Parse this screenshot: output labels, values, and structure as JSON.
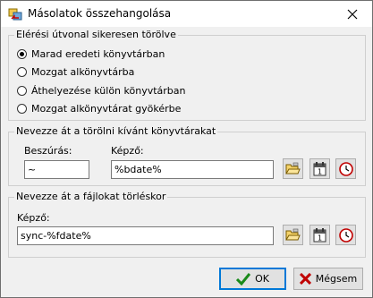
{
  "window": {
    "title": "Másolatok összehangolása"
  },
  "group1": {
    "title": "Elérési útvonal sikeresen törölve",
    "options": [
      {
        "label": "Marad eredeti könyvtárban",
        "checked": true
      },
      {
        "label": "Mozgat alkönyvtárba",
        "checked": false
      },
      {
        "label": "Áthelyezése külön könyvtárban",
        "checked": false
      },
      {
        "label": "Mozgat alkönyvtárat gyökérbe",
        "checked": false
      }
    ]
  },
  "group2": {
    "title": "Nevezze át a törölni kívánt könyvtárakat",
    "insert_label": "Beszúrás:",
    "insert_value": "~",
    "pattern_label": "Képző:",
    "pattern_value": "%bdate%"
  },
  "group3": {
    "title": "Nevezze át a fájlokat törléskor",
    "pattern_label": "Képző:",
    "pattern_value": "sync-%fdate%"
  },
  "buttons": {
    "ok": "OK",
    "cancel": "Mégsem"
  },
  "icons": {
    "app": "app-icon",
    "close": "close-icon",
    "folder": "folder-icon",
    "calendar": "calendar-icon",
    "clock": "clock-icon",
    "check": "check-icon",
    "cross": "cross-icon"
  }
}
